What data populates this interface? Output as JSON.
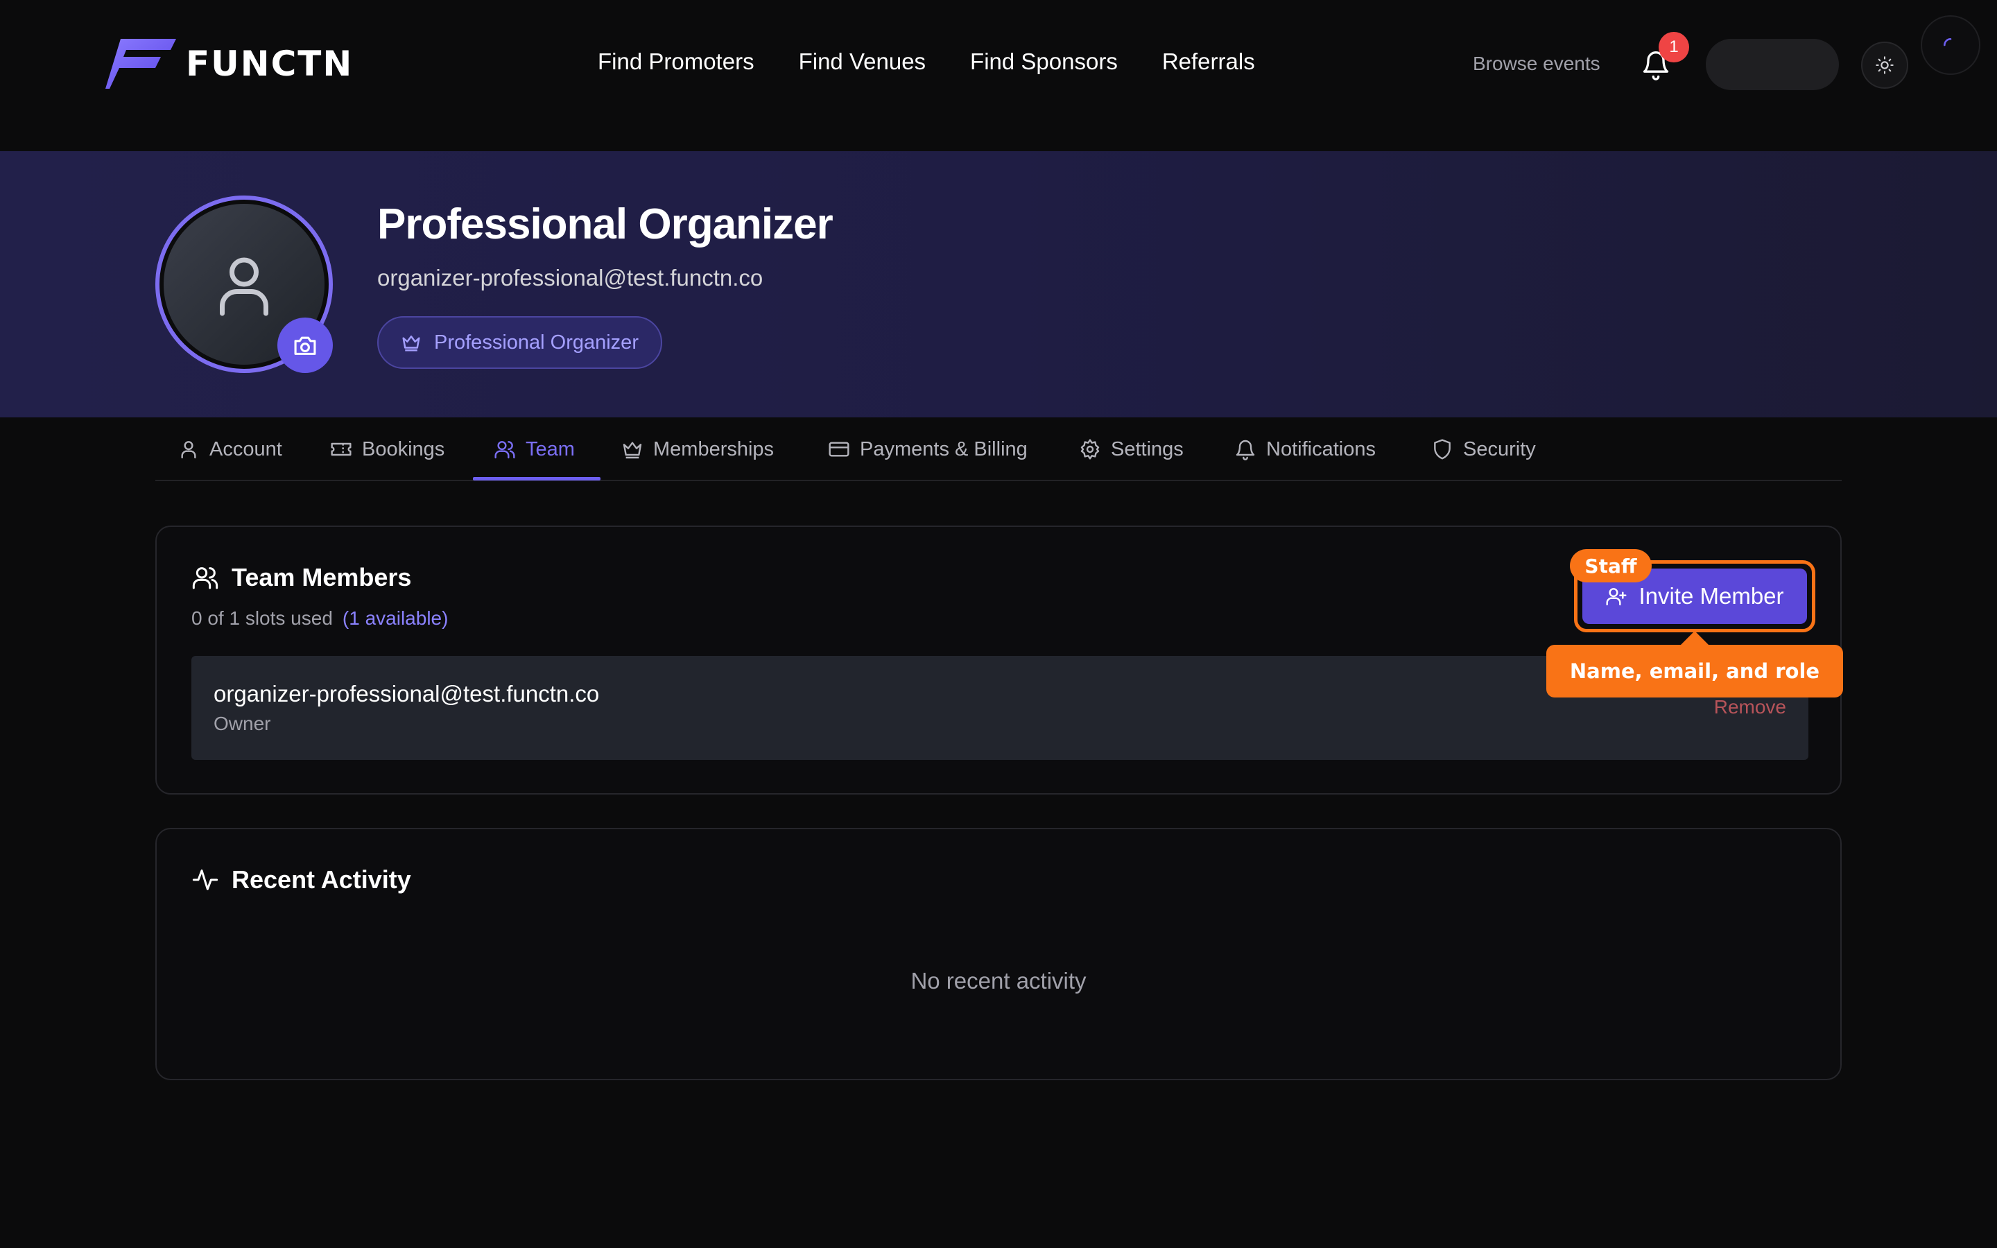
{
  "app": {
    "logo_text": "FUNCTN"
  },
  "nav": {
    "links": [
      "Find Promoters",
      "Find Venues",
      "Find Sponsors",
      "Referrals"
    ],
    "browse_label": "Browse events",
    "notification_count": "1",
    "icons": {
      "bell": "bell-icon",
      "theme": "sun-icon",
      "loading": "spinner-icon"
    }
  },
  "profile": {
    "name": "Professional Organizer",
    "email": "organizer-professional@test.functn.co",
    "role_badge": "Professional Organizer",
    "icons": {
      "avatar": "user-icon",
      "camera": "camera-icon",
      "badge": "crown-icon"
    }
  },
  "tabs": [
    {
      "label": "Account",
      "icon": "user-icon"
    },
    {
      "label": "Bookings",
      "icon": "ticket-icon"
    },
    {
      "label": "Team",
      "icon": "users-icon",
      "active": true
    },
    {
      "label": "Memberships",
      "icon": "crown-icon"
    },
    {
      "label": "Payments & Billing",
      "icon": "credit-card-icon"
    },
    {
      "label": "Settings",
      "icon": "gear-icon"
    },
    {
      "label": "Notifications",
      "icon": "bell-icon"
    },
    {
      "label": "Security",
      "icon": "shield-icon"
    }
  ],
  "team": {
    "title": "Team Members",
    "slots_text": "0 of 1 slots used",
    "available_text": "(1 available)",
    "invite_label": "Invite Member",
    "members": [
      {
        "email": "organizer-professional@test.functn.co",
        "role": "Owner",
        "action": "Remove"
      }
    ]
  },
  "annotation": {
    "tag": "Staff",
    "tooltip": "Name, email, and role"
  },
  "activity": {
    "title": "Recent Activity",
    "empty_text": "No recent activity"
  },
  "colors": {
    "background": "#0b0b0c",
    "accent": "#6557e8",
    "accent_text": "#7b6ff5",
    "annotation": "#f97316",
    "danger": "#b8545a",
    "badge_red": "#ef4444"
  }
}
